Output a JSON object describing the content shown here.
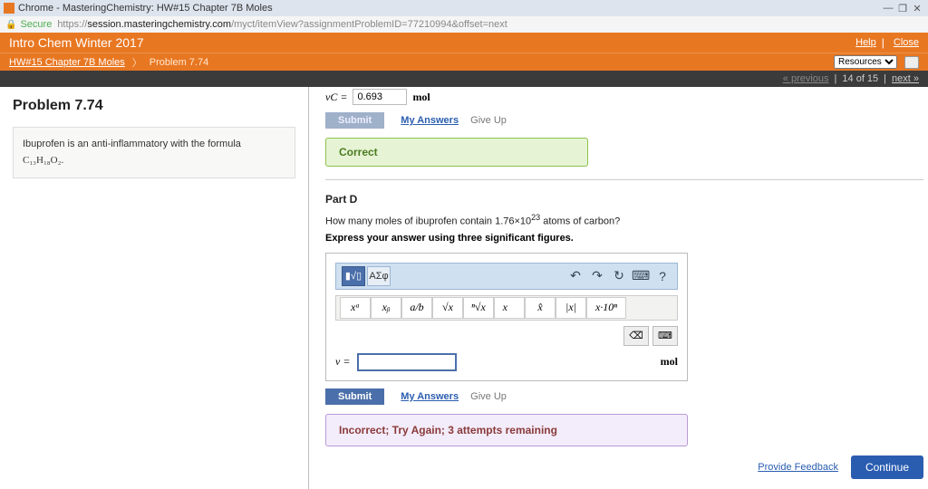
{
  "window": {
    "title": "Chrome - MasteringChemistry: HW#15 Chapter 7B Moles",
    "min": "—",
    "max": "❐",
    "close": "✕"
  },
  "url": {
    "secure": "Secure",
    "host": "session.masteringchemistry.com",
    "proto": "https://",
    "path": "/myct/itemView?assignmentProblemID=77210994&offset=next"
  },
  "course": {
    "title": "Intro Chem Winter 2017",
    "help": "Help",
    "close": "Close"
  },
  "crumb": {
    "assignment": "HW#15 Chapter 7B Moles",
    "problem": "Problem 7.74",
    "resources": "Resources"
  },
  "nav": {
    "prev": "« previous",
    "pos": "14 of 15",
    "next": "next »"
  },
  "left": {
    "heading": "Problem 7.74",
    "desc_pre": "Ibuprofen is an anti-inflammatory with the formula ",
    "formula": "C₁₃H₁₈O₂",
    "dot": "."
  },
  "prevPart": {
    "var": "νC =",
    "value": "0.693",
    "unit": "mol",
    "submit": "Submit",
    "myAnswers": "My Answers",
    "giveUp": "Give Up",
    "correct": "Correct"
  },
  "partD": {
    "title": "Part D",
    "question_a": "How many moles of ibuprofen contain 1.76×10",
    "question_exp": "23",
    "question_b": " atoms of carbon?",
    "instr": "Express your answer using three significant figures.",
    "greek": "ΑΣφ",
    "tools": {
      "undo": "↶",
      "redo": "↷",
      "reset": "↻",
      "kbd": "⌨",
      "help": "?"
    },
    "row2": [
      "xᵃ",
      "xᵦ",
      "a/b",
      "√x",
      "ⁿ√x",
      "x⃗",
      "x̂",
      "|x|",
      "x·10ⁿ"
    ],
    "bksp": "⌫",
    "kb2": "⌨",
    "var": "ν =",
    "unit": "mol",
    "submit": "Submit",
    "myAnswers": "My Answers",
    "giveUp": "Give Up",
    "feedback": "Incorrect; Try Again; 3 attempts remaining"
  },
  "footer": {
    "feedback": "Provide Feedback",
    "continue": "Continue"
  }
}
